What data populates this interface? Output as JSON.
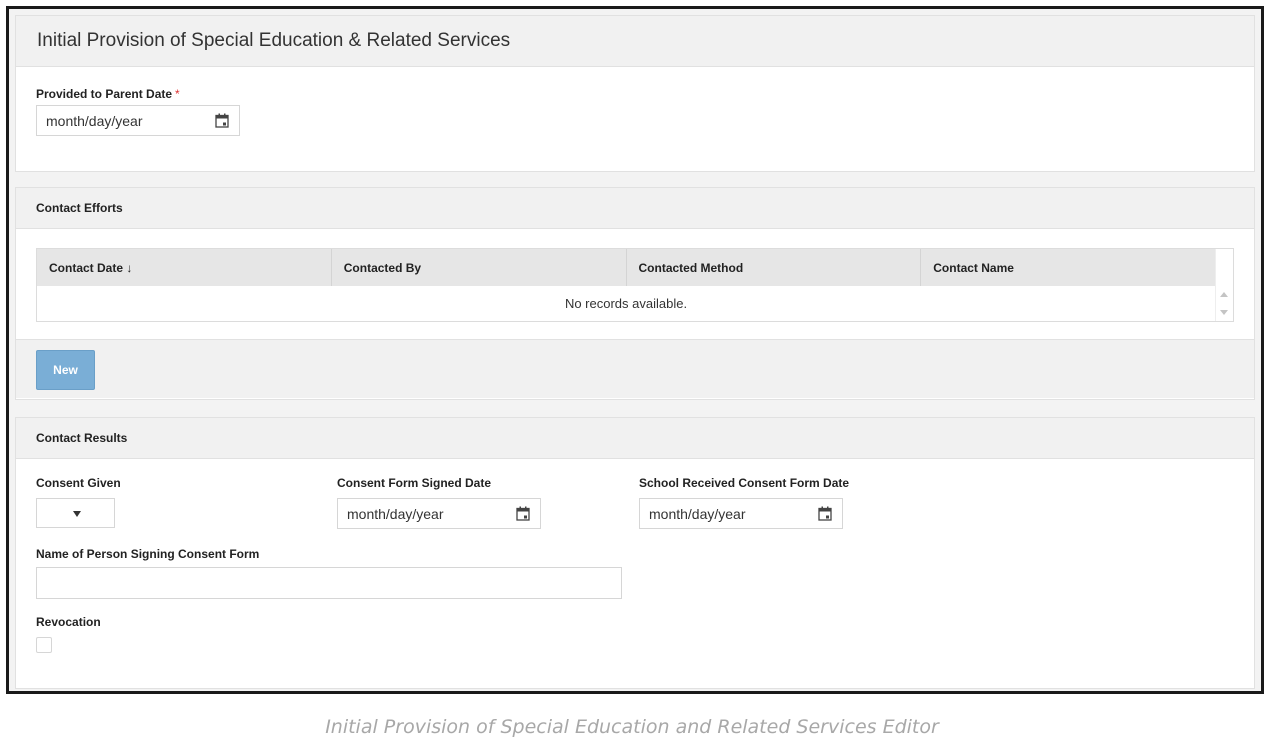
{
  "page": {
    "title": "Initial Provision of Special Education & Related Services"
  },
  "provided_section": {
    "provided_date_label": "Provided to Parent Date",
    "required_marker": "*",
    "provided_date_placeholder": "month/day/year"
  },
  "contact_efforts": {
    "title": "Contact Efforts",
    "columns": [
      "Contact Date ↓",
      "Contacted By",
      "Contacted Method",
      "Contact Name"
    ],
    "empty_message": "No records available.",
    "new_button": "New"
  },
  "contact_results": {
    "title": "Contact Results",
    "consent_given_label": "Consent Given",
    "consent_signed_label": "Consent Form Signed Date",
    "consent_signed_placeholder": "month/day/year",
    "school_received_label": "School Received Consent Form Date",
    "school_received_placeholder": "month/day/year",
    "name_signing_label": "Name of Person Signing Consent Form",
    "revocation_label": "Revocation"
  },
  "caption": "Initial Provision of Special Education and Related Services Editor",
  "icons": {
    "calendar": "calendar-icon",
    "sort": "arrow-down-icon",
    "dropdown": "caret-down-icon"
  },
  "colors": {
    "accent_button": "#7aaed6",
    "required": "#dd3333",
    "header_bg": "#f1f1f1"
  }
}
